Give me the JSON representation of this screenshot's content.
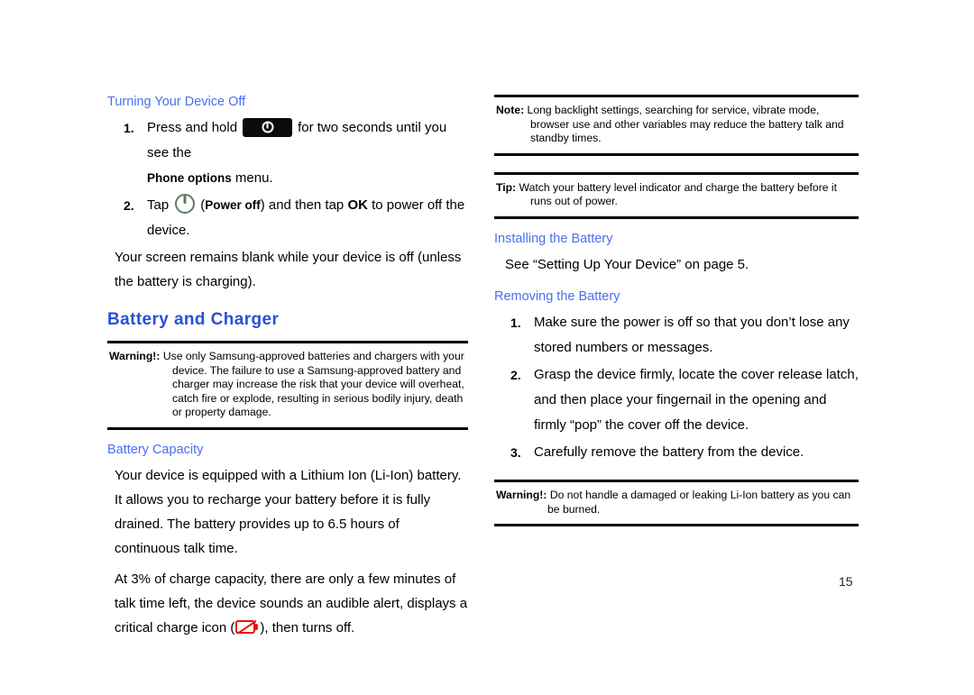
{
  "page": {
    "number": "15",
    "colors": {
      "section_heading": "#2a4fd6",
      "sub_heading": "#4a6ef0",
      "body_text": "#000000",
      "rule": "#000000",
      "battery_icon": "#ee1111",
      "power_icon": "#5f7a63"
    }
  },
  "left_column": {
    "heading_turning_off": "Turning Your Device Off",
    "steps": [
      {
        "num": "1.",
        "text_before_icon": "Press and hold",
        "icon": "power-key-icon",
        "text_after_icon": "for two seconds until you see the",
        "line2_bold": "Phone options",
        "line2_rest": " menu."
      },
      {
        "num": "2.",
        "text_before_icon": "Tap",
        "icon": "power-off-soft-key-icon",
        "paren_open": "(",
        "paren_bold": "Power off",
        "paren_close": ")",
        "text_mid": " and then tap ",
        "ok_bold": "OK",
        "text_after": " to power off the device."
      }
    ],
    "paragraph_blank_screen": "Your screen remains blank while your device is off (unless the battery is charging).",
    "heading_battery_and_charger": "Battery and Charger",
    "warning": {
      "label": "Warning!:",
      "text": "Use only Samsung-approved batteries and chargers with your device. The failure to use a Samsung-approved battery and charger may increase the risk that your device will overheat, catch fire or explode, resulting in serious bodily injury, death or property damage."
    },
    "heading_battery_capacity": "Battery Capacity",
    "paragraph_capacity": "Your device is equipped with a Lithium Ion (Li-Ion) battery. It allows you to recharge your battery before it is fully drained. The battery provides up to 6.5 hours of continuous talk time.",
    "paragraph_critical_before_icon": "At 3% of charge capacity, there are only a few minutes of talk time left, the device sounds an audible alert, displays a critical charge icon (",
    "paragraph_critical_icon": "critical-battery-icon",
    "paragraph_critical_after_icon": "), then turns off."
  },
  "right_column": {
    "note": {
      "label": "Note:",
      "text": "Long backlight settings, searching for service, vibrate mode, browser use and other variables may reduce the battery talk and standby times."
    },
    "tip": {
      "label": "Tip:",
      "text": "Watch your battery level indicator and charge the battery before it runs out of power."
    },
    "heading_installing": "Installing the Battery",
    "see_reference": "See “Setting Up Your Device” on page 5.",
    "heading_removing": "Removing the Battery",
    "steps": [
      {
        "num": "1.",
        "text": "Make sure the power is off so that you don’t lose any stored numbers or messages."
      },
      {
        "num": "2.",
        "text": "Grasp the device firmly, locate the cover release latch, and then place your fingernail in the opening and firmly “pop” the cover off the device."
      },
      {
        "num": "3.",
        "text": "Carefully remove the battery from the device."
      }
    ],
    "warning": {
      "label": "Warning!:",
      "text": "Do not handle a damaged or leaking Li-Ion battery as you can be burned."
    }
  }
}
